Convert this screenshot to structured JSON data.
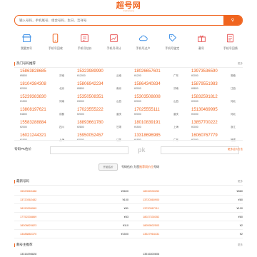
{
  "logo": {
    "title": "超号网",
    "subtitle": "chaohaowang"
  },
  "search": {
    "placeholder": "输入号码，手机尾号、组合号码、生日、吉祥号"
  },
  "nav": [
    {
      "label": "我要卖号",
      "icon": "shop-icon"
    },
    {
      "label": "手机号回收",
      "icon": "phone-icon"
    },
    {
      "label": "手机号估价",
      "icon": "calc-icon"
    },
    {
      "label": "手机号评分",
      "icon": "chart-icon"
    },
    {
      "label": "手机号过户",
      "icon": "cloud-icon"
    },
    {
      "label": "手机号鉴定",
      "icon": "tag-icon"
    },
    {
      "label": "靓号",
      "icon": "gift-icon"
    },
    {
      "label": "手机号回馈",
      "icon": "doc-icon"
    }
  ],
  "featured": {
    "title": "热门号码推荐",
    "more": "更多",
    "items": [
      {
        "number": "15863828685",
        "price": "¥5800",
        "loc": "济南"
      },
      {
        "number": "15323989990",
        "price": "¥12000",
        "loc": "云南"
      },
      {
        "number": "18026657601",
        "price": "¥1200",
        "loc": "广东"
      },
      {
        "number": "13973536590",
        "price": "¥2000",
        "loc": "湖南"
      },
      {
        "number": "18104384308",
        "price": "¥2000",
        "loc": "北京"
      },
      {
        "number": "15806942234",
        "price": "¥5800",
        "loc": "南京"
      },
      {
        "number": "15864340834",
        "price": "¥2000",
        "loc": "济南"
      },
      {
        "number": "15879551983",
        "price": "¥5800",
        "loc": "江西"
      },
      {
        "number": "15239383830",
        "price": "¥1500",
        "loc": "河南"
      },
      {
        "number": "15350508351",
        "price": "¥3000",
        "loc": "山西"
      },
      {
        "number": "15303508808",
        "price": "¥2000",
        "loc": "山西"
      },
      {
        "number": "15832591812",
        "price": "¥2000",
        "loc": "河北"
      },
      {
        "number": "13808197621",
        "price": "¥4800",
        "loc": "成都"
      },
      {
        "number": "17023555222",
        "price": "¥2000",
        "loc": "重庆"
      },
      {
        "number": "17025555111",
        "price": "¥2000",
        "loc": "重庆"
      },
      {
        "number": "15130469995",
        "price": "¥2000",
        "loc": "河北"
      },
      {
        "number": "15583288884",
        "price": "¥2000",
        "loc": "四川"
      },
      {
        "number": "18893661780",
        "price": "¥2800",
        "loc": "甘肃"
      },
      {
        "number": "18010839191",
        "price": "¥1500",
        "loc": "上海"
      },
      {
        "number": "13857700222",
        "price": "¥2000",
        "loc": "浙江"
      },
      {
        "number": "16021244321",
        "price": "¥1500",
        "loc": "上海"
      },
      {
        "number": "15950052457",
        "price": "¥2000",
        "loc": "江苏"
      },
      {
        "number": "13318696985",
        "price": "¥1800",
        "loc": "广东"
      },
      {
        "number": "16060767779",
        "price": "¥2000",
        "loc": "福建"
      }
    ]
  },
  "estimate": {
    "label": "号码PK估价",
    "vs": "pk",
    "link": "更多估价方法",
    "button": "开始估价",
    "note_prefix": "号码估价 为您",
    "note_hl": "推荐同价位",
    "note_suffix": "号码"
  },
  "recent": {
    "title": "最新号码",
    "more": "更多",
    "rows": [
      {
        "n1": "15323569488",
        "p1": "¥3600",
        "n2": "18032530252",
        "p2": "¥880"
      },
      {
        "n1": "13720362482",
        "p1": "¥100",
        "n2": "13720360900",
        "p2": "¥80"
      },
      {
        "n1": "18150396969",
        "p1": "¥81",
        "n2": "13720367111",
        "p2": "¥100"
      },
      {
        "n1": "17752336869",
        "p1": "¥83",
        "n2": "18027330352",
        "p2": "¥60"
      },
      {
        "n1": "18308820823",
        "p1": "¥110",
        "n2": "18059502503",
        "p2": "¥2"
      },
      {
        "n1": "13488882370",
        "p1": "¥1500",
        "n2": "13527964431",
        "p2": "¥2"
      }
    ]
  },
  "footer_list": {
    "title": "靓号主推荐",
    "more": "更多",
    "items": [
      "13316398828",
      "13516300606"
    ]
  }
}
